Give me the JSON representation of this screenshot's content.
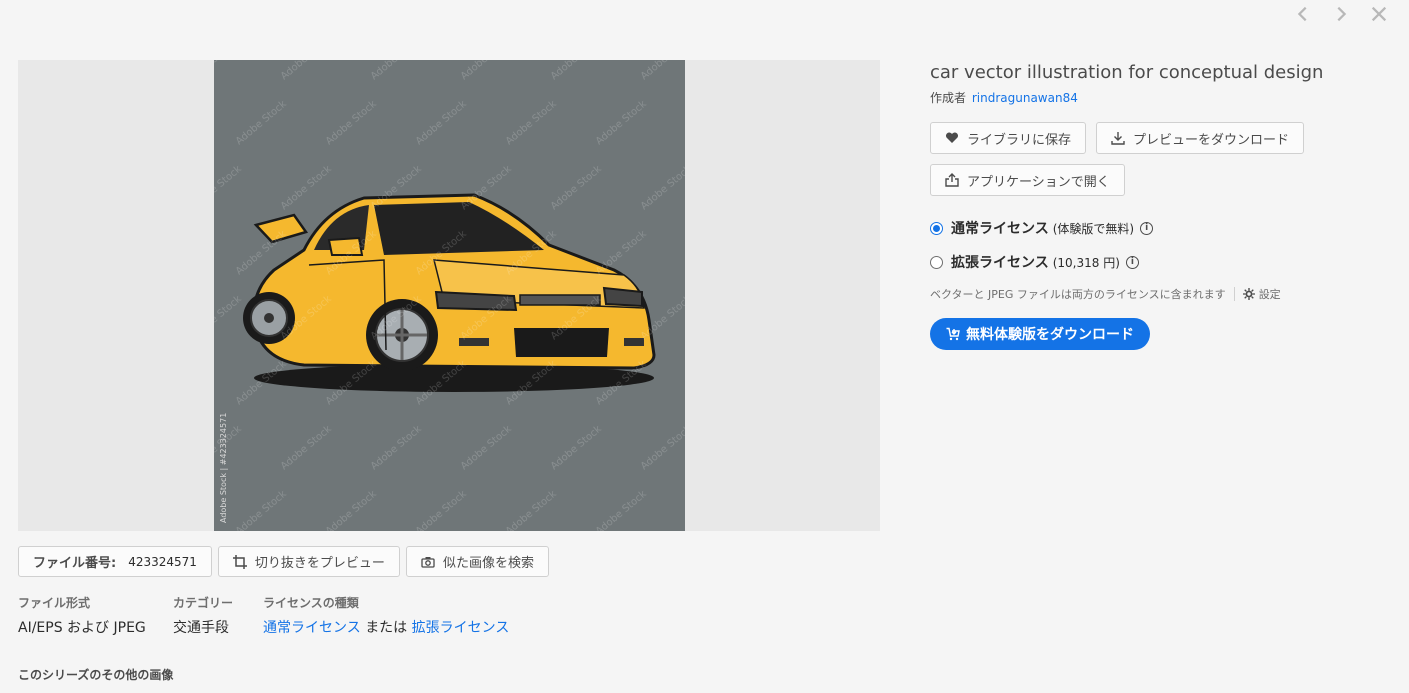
{
  "nav": {
    "prev_icon": "chevron-left-icon",
    "next_icon": "chevron-right-icon",
    "close_icon": "close-icon"
  },
  "preview": {
    "side_watermark": "Adobe Stock | #423324571",
    "watermark_text": "Adobe Stock"
  },
  "below": {
    "file_number_label": "ファイル番号:",
    "file_number_value": "423324571",
    "crop_preview_label": "切り抜きをプレビュー",
    "similar_search_label": "似た画像を検索"
  },
  "meta": {
    "file_type_header": "ファイル形式",
    "file_type_value": "AI/EPS および JPEG",
    "category_header": "カテゴリー",
    "category_value": "交通手段",
    "license_type_header": "ライセンスの種類",
    "license_standard_link": "通常ライセンス",
    "license_or": "または",
    "license_extended_link": "拡張ライセンス"
  },
  "series_heading": "このシリーズのその他の画像",
  "panel": {
    "title": "car vector illustration for conceptual design",
    "author_prefix": "作成者",
    "author_name": "rindragunawan84",
    "save_library": "ライブラリに保存",
    "download_preview": "プレビューをダウンロード",
    "open_in_app": "アプリケーションで開く",
    "standard_license": "通常ライセンス",
    "standard_license_note": "(体験版で無料)",
    "extended_license": "拡張ライセンス",
    "extended_license_note": "(10,318 円)",
    "included_note": "ベクターと JPEG ファイルは両方のライセンスに含まれます",
    "settings_label": "設定",
    "free_download": "無料体験版をダウンロード"
  },
  "colors": {
    "accent": "#1473e6",
    "car_body": "#f5b82e",
    "image_bg": "#6f7678"
  }
}
